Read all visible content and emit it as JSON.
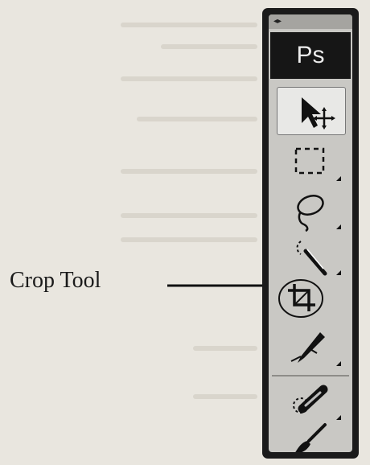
{
  "annotation": {
    "label": "Crop Tool"
  },
  "panel": {
    "logo": "Ps",
    "grip_glyph": "◂▸",
    "tools": [
      {
        "name": "move-tool",
        "icon": "move-icon",
        "active": true
      },
      {
        "name": "marquee-tool",
        "icon": "rectangular-marquee-icon"
      },
      {
        "name": "lasso-tool",
        "icon": "lasso-icon"
      },
      {
        "name": "quick-selection-tool",
        "icon": "quick-selection-icon"
      },
      {
        "name": "crop-tool",
        "icon": "crop-icon",
        "highlighted": true
      },
      {
        "name": "eyedropper-tool",
        "icon": "eyedropper-icon"
      },
      {
        "name": "healing-brush-tool",
        "icon": "healing-brush-icon"
      },
      {
        "name": "brush-tool",
        "icon": "brush-icon"
      }
    ]
  }
}
